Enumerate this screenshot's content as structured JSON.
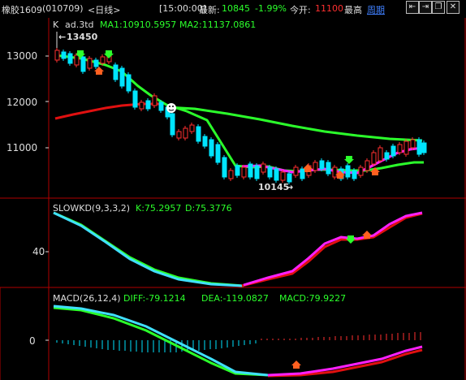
{
  "topbar": {
    "instrument": "橡胶1609",
    "code": "(010709)",
    "period": "<日线>",
    "time": "[15:00:00]",
    "latest_label": "最新:",
    "latest_value": "10845",
    "change_pct": "-1.99%",
    "open_label": "今开:",
    "open_value": "11100",
    "high_label": "最高",
    "week_link": "周期"
  },
  "main_panel": {
    "title_k": "K",
    "indicator": "ad.3td",
    "ma1": "MA1:10910.5957",
    "ma2": "MA2:11137.0861",
    "high_marker": "13450",
    "low_marker": "10145",
    "y_ticks": [
      "13000",
      "12000",
      "11000"
    ]
  },
  "kd_panel": {
    "title": "SLOWKD(9,3,3,2)",
    "k": "K:75.2957",
    "d": "D:75.3776",
    "y_tick": "40"
  },
  "macd_panel": {
    "title": "MACD(26,12,4)",
    "diff": "DIFF:-79.1214",
    "dea": "DEA:-119.0827",
    "macd": "MACD:79.9227",
    "y_tick": "0"
  },
  "colors": {
    "up": "#ff3030",
    "down": "#00e5ff",
    "ma_green": "#2bff2b",
    "ma_red": "#e01010",
    "kd_pink": "#ff20ff",
    "kd_cyan": "#40e0ff",
    "grid": "#b00000",
    "axis_text": "#dddddd"
  }
}
